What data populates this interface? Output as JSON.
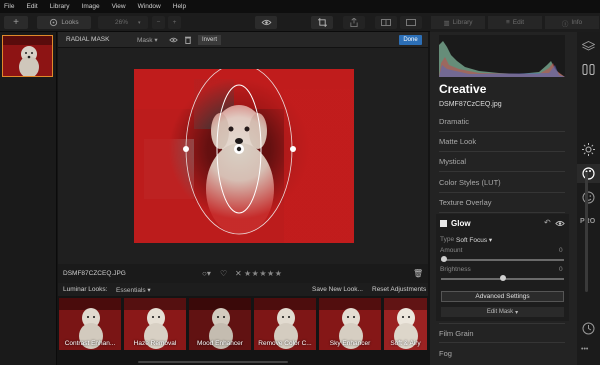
{
  "menu": [
    "File",
    "Edit",
    "Library",
    "Image",
    "View",
    "Window",
    "Help"
  ],
  "toolbar": {
    "add": "+",
    "looks": "Looks",
    "zoom": "26%",
    "zoom_out": "−",
    "zoom_in": "+"
  },
  "right_tabs": {
    "library": "Library",
    "edit": "Edit",
    "info": "Info"
  },
  "mask": {
    "title": "RADIAL MASK",
    "dropdown": "Mask",
    "invert": "Invert",
    "done": "Done"
  },
  "image": {
    "filename": "DSMF87CZCEQ.JPG"
  },
  "looks": {
    "label": "Luminar Looks:",
    "category": "Essentials",
    "save": "Save New Look...",
    "reset": "Reset Adjustments",
    "items": [
      {
        "label": "Contrast Enhan..."
      },
      {
        "label": "Haze Removal"
      },
      {
        "label": "Mood Enhancer"
      },
      {
        "label": "Remove Color C..."
      },
      {
        "label": "Sky Enhancer"
      },
      {
        "label": "Soft & Airy"
      }
    ]
  },
  "panel": {
    "title": "Creative",
    "filename": "DSMF87CzCEQ.jpg",
    "sections": [
      "Dramatic",
      "Matte Look",
      "Mystical",
      "Color Styles (LUT)",
      "Texture Overlay"
    ],
    "glow": {
      "title": "Glow",
      "type_label": "Type",
      "type_value": "Soft Focus",
      "amount_label": "Amount",
      "amount_value": "0",
      "amount_fraction": 0.0,
      "brightness_label": "Brightness",
      "brightness_value": "0",
      "brightness_fraction": 0.5,
      "advanced": "Advanced Settings",
      "edit_mask": "Edit Mask"
    },
    "sections_after": [
      "Film Grain",
      "Fog"
    ]
  },
  "side_icons": {
    "pro_label": "PRO",
    "more_label": "•••"
  },
  "colors": {
    "accent": "#2c6fb7",
    "thumb_border": "#e08a2a",
    "mask_red": "#c41d1d"
  }
}
